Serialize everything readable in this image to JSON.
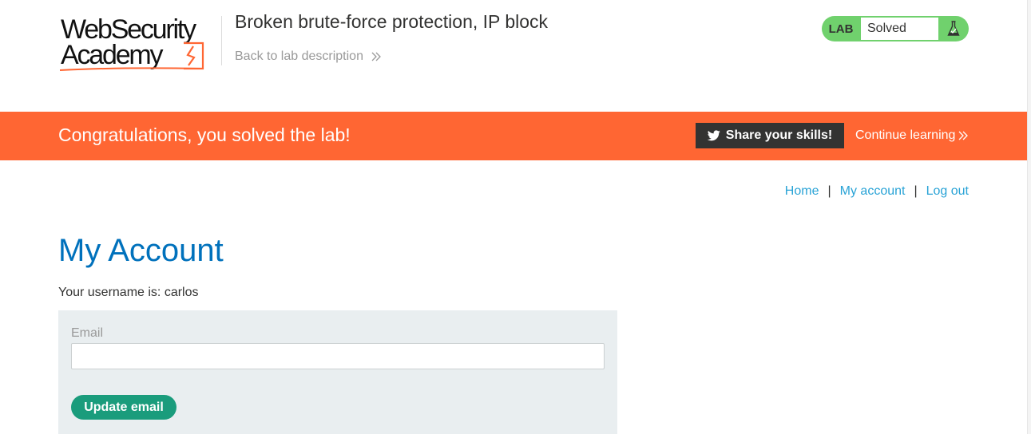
{
  "header": {
    "logo": {
      "line1": "WebSecurity",
      "line2": "Academy"
    },
    "lab_title": "Broken brute-force protection, IP block",
    "back_link": "Back to lab description"
  },
  "lab_status": {
    "label": "LAB",
    "status": "Solved",
    "color": "#70d16d",
    "icon": "flask-icon"
  },
  "banner": {
    "message": "Congratulations, you solved the lab!",
    "share_button": "Share your skills!",
    "continue_link": "Continue learning",
    "color": "#ff6633"
  },
  "nav": {
    "home": "Home",
    "separator": "|",
    "my_account": "My account",
    "log_out": "Log out"
  },
  "main": {
    "title": "My Account",
    "username_line": "Your username is: carlos",
    "email_label": "Email",
    "email_value": "",
    "update_button": "Update email"
  }
}
